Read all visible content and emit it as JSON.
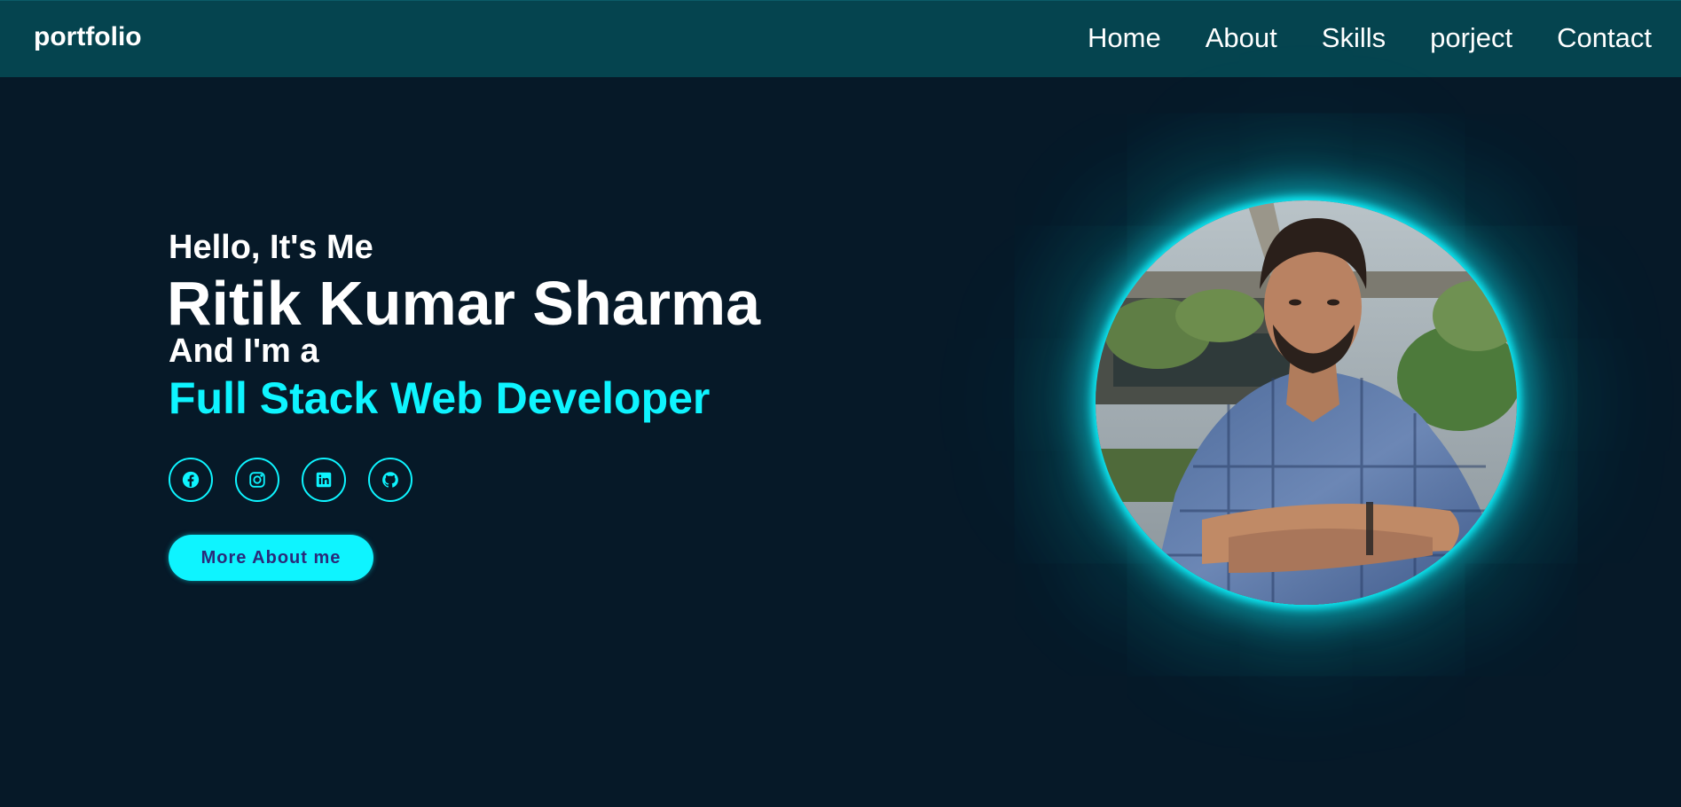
{
  "nav": {
    "logo": "portfolio",
    "links": [
      "Home",
      "About",
      "Skills",
      "porject",
      "Contact"
    ]
  },
  "hero": {
    "greeting": "Hello, It's Me",
    "name": "Ritik Kumar Sharma",
    "intro": "And I'm a",
    "role": "Full Stack Web Developer",
    "socials": [
      "facebook-icon",
      "instagram-icon",
      "linkedin-icon",
      "github-icon"
    ],
    "cta_label": "More About me"
  },
  "colors": {
    "background": "#061928",
    "navbar": "#05444f",
    "accent": "#0ef4ff",
    "cta_text": "#2a2a7a"
  }
}
